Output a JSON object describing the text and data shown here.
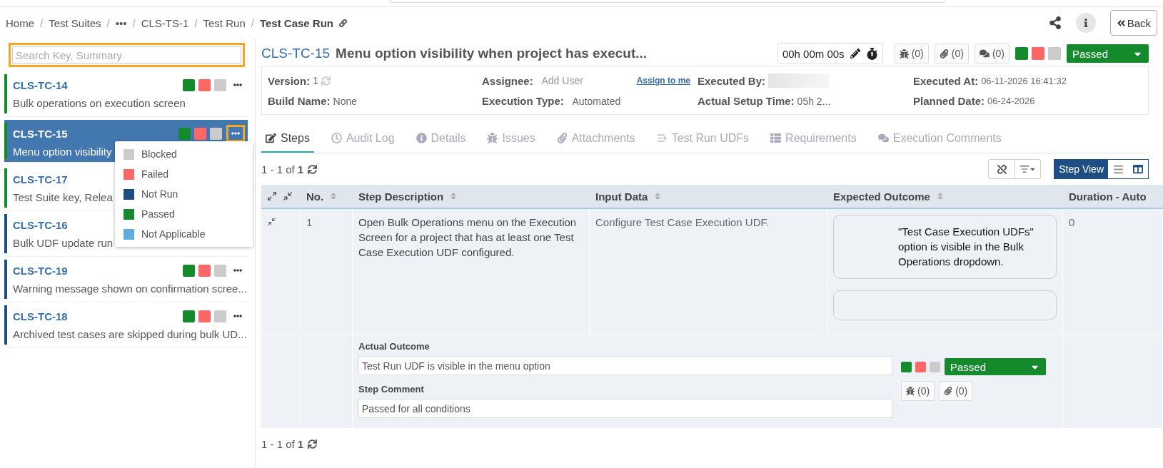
{
  "breadcrumb": [
    {
      "label": "Home",
      "separator": "/"
    },
    {
      "label": "Test Suites",
      "separator": "/"
    },
    {
      "label": "•••",
      "separator": "/"
    },
    {
      "label": "CLS-TS-1",
      "separator": "/"
    },
    {
      "label": "Test Run",
      "separator": "/"
    }
  ],
  "page_title": "Test Case Run",
  "back_button": "Back",
  "sidebar": {
    "search": {
      "placeholder": "Search Key, Summary"
    },
    "items": [
      {
        "key": "CLS-TC-14",
        "summary": "Bulk operations on execution screen",
        "selected": false,
        "color": "#158a2c"
      },
      {
        "key": "CLS-TC-15",
        "summary": "Menu option visibility",
        "selected": true,
        "color": "#158a2c"
      },
      {
        "key": "CLS-TC-17",
        "summary": "Test Suite key, Relea",
        "selected": false,
        "color": "#158a2c"
      },
      {
        "key": "CLS-TC-16",
        "summary": "Bulk UDF update run",
        "selected": false,
        "color": "#1f4e85"
      },
      {
        "key": "CLS-TC-19",
        "summary": "Warning message shown on confirmation scree...",
        "selected": false,
        "color": "#1f4e85"
      },
      {
        "key": "CLS-TC-18",
        "summary": "Archived test cases are skipped during bulk UD...",
        "selected": false,
        "color": "#1f4e85"
      }
    ],
    "status_menu_open": true,
    "status_menu": [
      {
        "label": "Blocked",
        "color": "#cccccc"
      },
      {
        "label": "Failed",
        "color": "#ff6666"
      },
      {
        "label": "Not Run",
        "color": "#1f4e85"
      },
      {
        "label": "Passed",
        "color": "#158a2c"
      },
      {
        "label": "Not Applicable",
        "color": "#5dade2"
      }
    ]
  },
  "header": {
    "key": "CLS-TC-15",
    "title": "Menu option visibility when project has execut...",
    "timer": "00h 00m 00s",
    "issues": "(0)",
    "attachments": "(0)",
    "comments": "(0)",
    "status": "Passed"
  },
  "info": {
    "version_label": "Version:",
    "version": "1",
    "assignee_label": "Assignee:",
    "assignee_placeholder": "Add User",
    "assign_link": "Assign to me",
    "executed_by_label": "Executed By:",
    "executed_at_label": "Executed At:",
    "executed_at": "06-11-2026 16:41:32",
    "build_label": "Build Name:",
    "build": "None",
    "exec_type_label": "Execution Type:",
    "exec_type": "Automated",
    "setup_label": "Actual Setup Time:",
    "setup": "05h 2...",
    "planned_label": "Planned Date:",
    "planned": "06-24-2026"
  },
  "tabs": [
    {
      "label": "Steps",
      "selected": true
    },
    {
      "label": "Audit Log",
      "selected": false
    },
    {
      "label": "Details",
      "selected": false
    },
    {
      "label": "Issues",
      "selected": false
    },
    {
      "label": "Attachments",
      "selected": false
    },
    {
      "label": "Test Run UDFs",
      "selected": false
    },
    {
      "label": "Requirements",
      "selected": false
    },
    {
      "label": "Execution Comments",
      "selected": false
    }
  ],
  "pager": "1 - 1 of **1**",
  "view_button": {
    "label": "Step View",
    "selected": true
  },
  "table": {
    "columns": [
      "No.",
      "Step Description",
      "Input Data",
      "Expected Outcome",
      "Duration - Auto"
    ],
    "rows": [
      {
        "no": "1",
        "description": "Open Bulk Operations menu on the Execution Screen for a project that has at least one Test Case Execution UDF configured.",
        "input": "Configure Test Case Execution UDF.",
        "expected": "\"Test Case Execution UDFs\" option is visible in the Bulk Operations dropdown.",
        "duration": "0",
        "actual_label": "Actual Outcome",
        "actual": "Test Run UDF is visible in the menu option",
        "comment_label": "Step Comment",
        "comment": "Passed for all conditions",
        "status": "Passed",
        "issues": "(0)",
        "attachments": "(0)"
      }
    ]
  },
  "pager_bottom": "1 - 1 of **1**"
}
